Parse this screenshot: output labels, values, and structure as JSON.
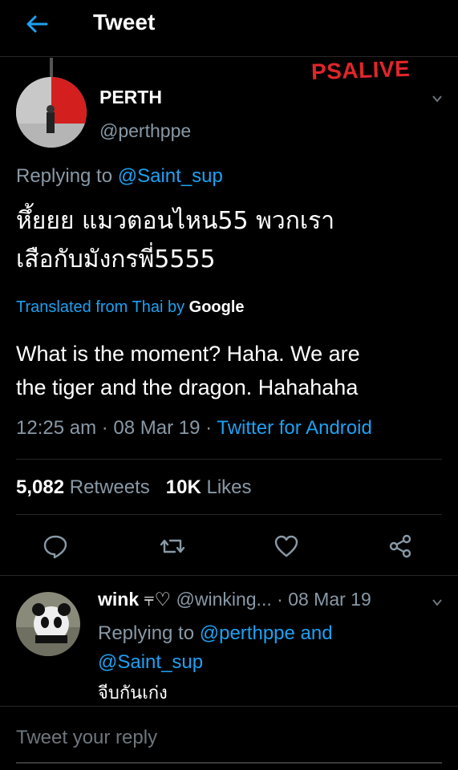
{
  "header": {
    "title": "Tweet"
  },
  "watermark": "PSALIVE",
  "tweet": {
    "name": "PERTH",
    "handle": "@perthppe",
    "replying_prefix": "Replying to",
    "replying_to": "@Saint_sup",
    "text_line1": "หึ้ยยย แมวตอนไหน55 พวกเรา",
    "text_line2": "เสือกับมังกรพี่5555",
    "translated_prefix": "Translated from Thai by",
    "translated_by": "Google",
    "translation_line1": "What is the moment? Haha. We are",
    "translation_line2": "the tiger and the dragon. Hahahaha",
    "time": "12:25 am",
    "date": "08 Mar 19",
    "source": "Twitter for Android",
    "retweets_count": "5,082",
    "retweets_label": "Retweets",
    "likes_count": "10K",
    "likes_label": "Likes"
  },
  "reply": {
    "name": "wink",
    "name_emoji": "⫧♡",
    "handle": "@winking...",
    "date": "08 Mar 19",
    "replying_prefix": "Replying to",
    "replying_to_1": "@perthppe",
    "and": "and",
    "replying_to_2": "@Saint_sup",
    "text": "จีบกันเก่ง"
  },
  "compose": {
    "placeholder": "Tweet your reply"
  },
  "colors": {
    "link": "#1da1f2",
    "muted": "#8899a6",
    "watermark": "#e0262b"
  }
}
